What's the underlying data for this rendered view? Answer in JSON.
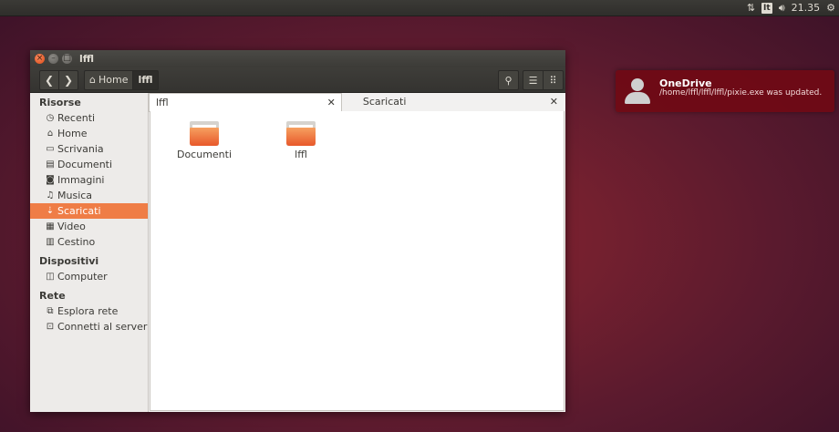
{
  "panel": {
    "keyboard_layout": "It",
    "clock": "21.35",
    "icons": [
      "network-arrows-icon",
      "speaker-icon",
      "gear-icon"
    ]
  },
  "window": {
    "title": "lffl",
    "controls": [
      "close-icon",
      "minimize-icon",
      "maximize-icon"
    ]
  },
  "toolbar": {
    "breadcrumb": [
      {
        "label": "Home",
        "icon": "home-icon"
      },
      {
        "label": "lffl"
      }
    ],
    "right_buttons": [
      "search-icon",
      "list-view-icon",
      "grid-view-icon"
    ]
  },
  "sidebar": {
    "sections": [
      {
        "heading": "Risorse",
        "items": [
          {
            "label": "Recenti",
            "icon": "clock-icon"
          },
          {
            "label": "Home",
            "icon": "home-icon"
          },
          {
            "label": "Scrivania",
            "icon": "desktop-icon"
          },
          {
            "label": "Documenti",
            "icon": "document-icon"
          },
          {
            "label": "Immagini",
            "icon": "camera-icon"
          },
          {
            "label": "Musica",
            "icon": "music-icon"
          },
          {
            "label": "Scaricati",
            "icon": "download-icon",
            "active": true
          },
          {
            "label": "Video",
            "icon": "film-icon"
          },
          {
            "label": "Cestino",
            "icon": "trash-icon"
          }
        ]
      },
      {
        "heading": "Dispositivi",
        "items": [
          {
            "label": "Computer",
            "icon": "drive-icon"
          }
        ]
      },
      {
        "heading": "Rete",
        "items": [
          {
            "label": "Esplora rete",
            "icon": "network-icon"
          },
          {
            "label": "Connetti al server",
            "icon": "server-icon"
          }
        ]
      }
    ]
  },
  "tabs": [
    {
      "label": "lffl",
      "active": true
    },
    {
      "label": "Scaricati",
      "active": false
    }
  ],
  "files": [
    {
      "name": "Documenti",
      "type": "folder"
    },
    {
      "name": "lffl",
      "type": "folder"
    }
  ],
  "notification": {
    "title": "OneDrive",
    "body": "/home/lffl/lffl/lffl/pixie.exe was updated."
  },
  "colors": {
    "accent": "#ef7d46",
    "notification_bg": "#700a14",
    "panel_bg": "#3b3a36"
  }
}
